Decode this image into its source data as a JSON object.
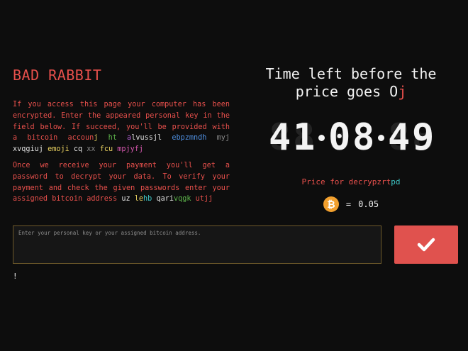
{
  "title": "BAD RABBIT",
  "paragraph1": [
    {
      "t": "If you access this page your computer has been encrypted. Enter the appeared personal key in the field below. If succeed, you'll be provided with a bitcoin accoun",
      "c": "c-o"
    },
    {
      "t": "j ",
      "c": "c-y"
    },
    {
      "t": "ht ",
      "c": "c-g"
    },
    {
      "t": "a",
      "c": "c-p"
    },
    {
      "t": "lvussjl ",
      "c": "c-w"
    },
    {
      "t": "ebpzmndh ",
      "c": "c-b"
    },
    {
      "t": "myj ",
      "c": "c-gr"
    },
    {
      "t": "xvqgiuj ",
      "c": "c-w"
    },
    {
      "t": "emoji ",
      "c": "c-y"
    },
    {
      "t": "cq ",
      "c": "c-w"
    },
    {
      "t": "xx ",
      "c": "c-gr"
    },
    {
      "t": "fcu ",
      "c": "c-y"
    },
    {
      "t": "mpjyfj",
      "c": "c-m"
    }
  ],
  "paragraph2": [
    {
      "t": "Once we receive your payment you'll get a password to decrypt your data. To verify your payment and check the given passwords enter your assigned bitcoin address ",
      "c": "c-o"
    },
    {
      "t": "uz ",
      "c": "c-w"
    },
    {
      "t": "le",
      "c": "c-y"
    },
    {
      "t": "hb ",
      "c": "c-c"
    },
    {
      "t": "qari",
      "c": "c-w"
    },
    {
      "t": "vqgk ",
      "c": "c-g"
    },
    {
      "t": "utjj",
      "c": "c-o"
    }
  ],
  "heading": {
    "line1": "Time left before the",
    "line2_prefix": "price goes O",
    "line2_red": "j"
  },
  "timer": {
    "hours": "41",
    "minutes": "08",
    "seconds": "49"
  },
  "price_label_parts": [
    {
      "t": "Price for decry",
      "c": "c-o"
    },
    {
      "t": "pzrt",
      "c": "c-o"
    },
    {
      "t": "pd",
      "c": "c-c"
    }
  ],
  "price": {
    "symbol": "₿",
    "equals": "=",
    "amount": "0.05"
  },
  "input": {
    "placeholder": "Enter your personal key or your assigned bitcoin address.",
    "value": ""
  },
  "status_text": "!",
  "colors": {
    "accent": "#e8504c",
    "background": "#0d0d0d",
    "bitcoin": "#f2a02e",
    "submit_button": "#e0524e"
  },
  "icons": {
    "submit": "checkmark-icon",
    "price": "bitcoin-icon"
  }
}
